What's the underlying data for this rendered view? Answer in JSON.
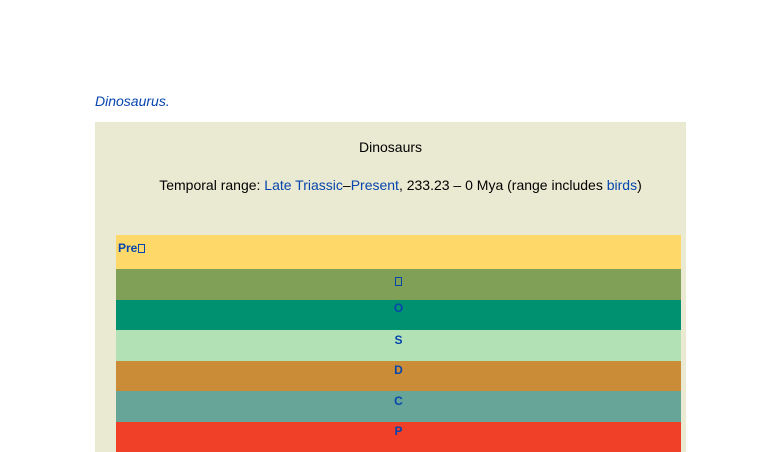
{
  "intro": {
    "link_text": "Dinosaurus",
    "trailing": "."
  },
  "infobox": {
    "title": "Dinosaurs",
    "range_label": "Temporal range: ",
    "range_start_link": "Late Triassic",
    "range_sep": "–",
    "range_end_link": "Present",
    "range_text": ", 233.23 – 0 Mya (range includes ",
    "birds_link": "birds",
    "range_close": ")"
  },
  "timescale": {
    "bands": [
      {
        "label": "Pre",
        "color": "#fed96a",
        "tofu": true
      },
      {
        "label": "",
        "color": "#7fa056",
        "tofu": true
      },
      {
        "label": "O",
        "color": "#009270",
        "tofu": false
      },
      {
        "label": "S",
        "color": "#b3e1b6",
        "tofu": false
      },
      {
        "label": "D",
        "color": "#cb8c37",
        "tofu": false
      },
      {
        "label": "C",
        "color": "#67a599",
        "tofu": false
      },
      {
        "label": "P",
        "color": "#f04028",
        "tofu": false
      }
    ]
  }
}
